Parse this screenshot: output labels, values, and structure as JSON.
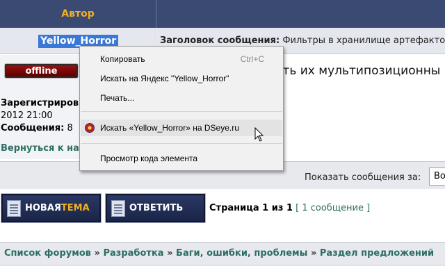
{
  "table_header": {
    "author": "Автор"
  },
  "post": {
    "author_name": "Yellow_Horror",
    "subject_label": "Заголовок сообщения:",
    "subject_text": "Фильтры в хранилище артефакто",
    "status_badge": "offline",
    "registered_label": "Зарегистриров",
    "registered_date": "2012 21:00",
    "messages_label": "Сообщения:",
    "messages_count": "8",
    "back_link": "Вернуться к на",
    "body_text_fragment": "ать их мультипозиционны"
  },
  "bottom_bar": {
    "show_label": "Показать сообщения за:",
    "show_select_value": "Во"
  },
  "actions": {
    "new_topic_main": "НОВАЯ ",
    "new_topic_accent": "ТЕМА",
    "reply": "ОТВЕТИТЬ"
  },
  "pagination": {
    "page_text": "Страница 1 из 1",
    "count_open": "[",
    "count_text": "1 сообщение",
    "count_close": "]"
  },
  "breadcrumbs": {
    "items": [
      "Список форумов",
      "Разработка",
      "Баги, ошибки, проблемы",
      "Раздел предложений"
    ],
    "separator": "»"
  },
  "context_menu": {
    "items": [
      {
        "label": "Копировать",
        "shortcut": "Ctrl+C",
        "icon": null
      },
      {
        "label": "Искать на Яндекс \"Yellow_Horror\"",
        "shortcut": "",
        "icon": null
      },
      {
        "label": "Печать...",
        "shortcut": "",
        "icon": null
      },
      {
        "label": "Искать «Yellow_Horror» на DSeye.ru",
        "shortcut": "",
        "icon": "dseye-icon"
      },
      {
        "label": "Просмотр кода элемента",
        "shortcut": "",
        "icon": null
      }
    ]
  },
  "colors": {
    "header_bg": "#3a4a73",
    "accent_yellow": "#f0b020",
    "link_green": "#2c6e63",
    "selection_blue": "#3a78d6",
    "offline_red": "#7a0a0a"
  }
}
